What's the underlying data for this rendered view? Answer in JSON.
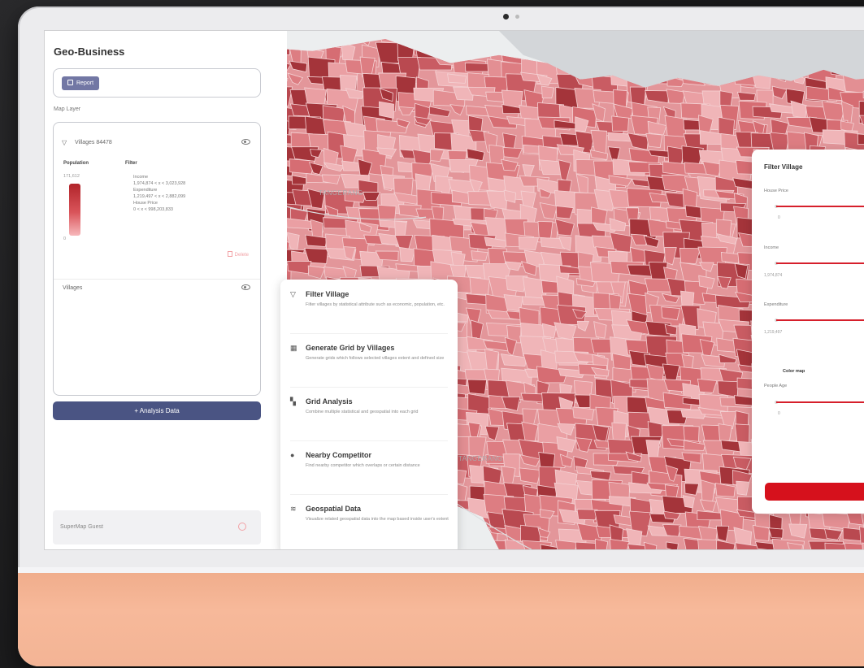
{
  "app": {
    "title": "Geo-Business"
  },
  "sidebar": {
    "report_button": "Report",
    "map_layer_label": "Map Layer",
    "layers": [
      {
        "name": "Villages 84478",
        "legend": {
          "population_label": "Population",
          "filter_label": "Filter",
          "max_value": "171,612",
          "min_value": "0",
          "filters": [
            {
              "name": "Income",
              "range": "1,974,874 < x < 3,023,928"
            },
            {
              "name": "Expenditure",
              "range": "1,219,497 < x < 2,882,099"
            },
            {
              "name": "House Price",
              "range": "0 < x < 998,203,833"
            }
          ],
          "color_ramp": [
            "#b1242a",
            "#d9545a",
            "#f7b8bb"
          ]
        },
        "delete_label": "Delete"
      },
      {
        "name": "Villages"
      }
    ],
    "analysis_button": "+ Analysis Data",
    "user": {
      "name": "SuperMap Guest"
    }
  },
  "map": {
    "labels": [
      "TANGERANG",
      "TANGERANG"
    ],
    "choropleth_colors": [
      "#a4343a",
      "#b94950",
      "#c95c63",
      "#d66d73",
      "#dd7d82",
      "#e38f93",
      "#ea9fa3",
      "#f0b5b8"
    ]
  },
  "analysis_menu": {
    "items": [
      {
        "title": "Filter Village",
        "icon": "filter-icon",
        "description": "Filter villages by statistical attribute such as economic, population, etc."
      },
      {
        "title": "Generate Grid by Villages",
        "icon": "grid-icon",
        "description": "Generate grids which follows selected villages extent and defined size"
      },
      {
        "title": "Grid Analysis",
        "icon": "grid-analysis-icon",
        "description": "Combine multiple statistical and geospatial into each grid"
      },
      {
        "title": "Nearby Competitor",
        "icon": "location-pin-icon",
        "description": "Find nearby competitor which overlaps or certain distance"
      },
      {
        "title": "Geospatial Data",
        "icon": "layers-icon",
        "description": "Visualize related geospatial data into the map based inside user's extent"
      }
    ]
  },
  "filter_panel": {
    "title": "Filter Village",
    "fields": [
      {
        "label": "House Price",
        "value": "0"
      },
      {
        "label": "Income",
        "value": "1,974,874"
      },
      {
        "label": "Expenditure",
        "value": "1,219,497"
      }
    ],
    "color_map_label": "Color map",
    "people_age": {
      "label": "People Age",
      "value": "0"
    },
    "accent": "#d6111c"
  },
  "device": {
    "chin_color": "#f4b394"
  }
}
